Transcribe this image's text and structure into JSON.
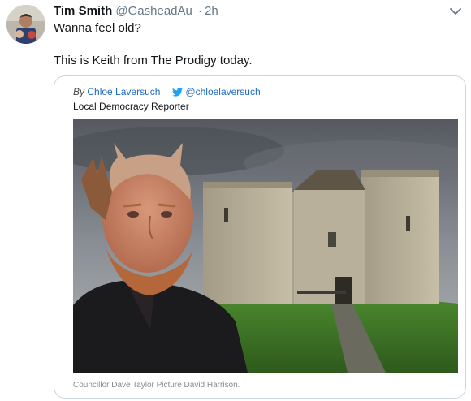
{
  "tweet": {
    "author_name": "Tim Smith",
    "author_handle": "@GasheadAu",
    "separator": "·",
    "time": "2h",
    "lines": [
      "Wanna feel old?",
      "This is Keith from The Prodigy today."
    ]
  },
  "card": {
    "by_label": "By",
    "author": "Chloe Laversuch",
    "twitter_handle": "@chloelaversuch",
    "role": "Local Democracy Reporter",
    "caption": "Councillor Dave Taylor Picture David Harrison."
  },
  "icons": {
    "menu": "chevron-down-icon",
    "twitter": "twitter-bird-icon"
  },
  "colors": {
    "link": "#1f6bbf",
    "twitter_blue": "#1da1f2",
    "muted": "#657786",
    "border": "#ccd6dd"
  }
}
